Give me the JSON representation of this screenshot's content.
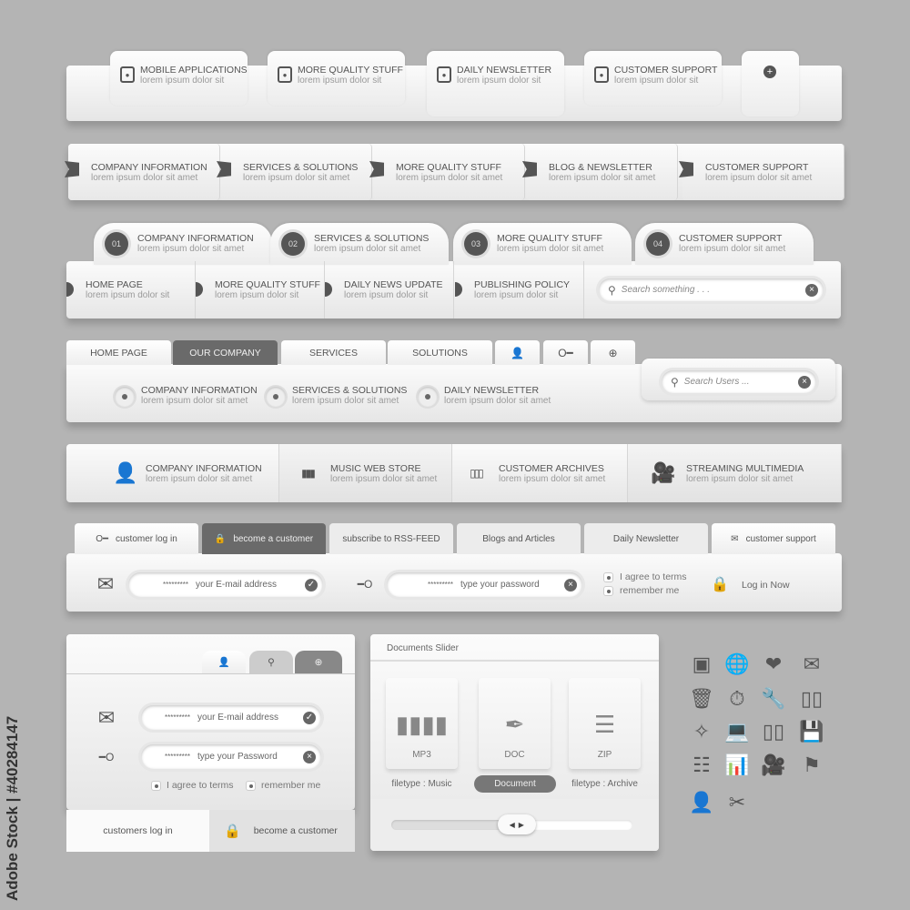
{
  "watermark": "Adobe Stock | #40284147",
  "row1": {
    "tabs": [
      {
        "title": "MOBILE APPLICATIONS",
        "sub": "lorem ipsum dolor sit"
      },
      {
        "title": "MORE QUALITY STUFF",
        "sub": "lorem ipsum dolor sit"
      },
      {
        "title": "DAILY NEWSLETTER",
        "sub": "lorem ipsum dolor sit"
      },
      {
        "title": "CUSTOMER SUPPORT",
        "sub": "lorem ipsum dolor sit"
      }
    ],
    "add_icon": "plus-circle-icon"
  },
  "row2": {
    "items": [
      {
        "title": "COMPANY INFORMATION",
        "sub": "lorem ipsum dolor sit amet"
      },
      {
        "title": "SERVICES & SOLUTIONS",
        "sub": "lorem ipsum dolor sit amet"
      },
      {
        "title": "MORE QUALITY STUFF",
        "sub": "lorem ipsum dolor sit amet"
      },
      {
        "title": "BLOG & NEWSLETTER",
        "sub": "lorem ipsum dolor sit amet"
      },
      {
        "title": "CUSTOMER SUPPORT",
        "sub": "lorem ipsum dolor sit amet"
      }
    ]
  },
  "row3": {
    "tabs": [
      {
        "num": "01",
        "title": "COMPANY INFORMATION",
        "sub": "lorem ipsum dolor sit amet"
      },
      {
        "num": "02",
        "title": "SERVICES & SOLUTIONS",
        "sub": "lorem ipsum dolor sit amet"
      },
      {
        "num": "03",
        "title": "MORE QUALITY STUFF",
        "sub": "lorem ipsum dolor sit amet"
      },
      {
        "num": "04",
        "title": "CUSTOMER SUPPORT",
        "sub": "lorem ipsum dolor sit amet"
      }
    ],
    "items": [
      {
        "title": "HOME PAGE",
        "sub": "lorem ipsum dolor sit"
      },
      {
        "title": "MORE QUALITY STUFF",
        "sub": "lorem ipsum dolor sit"
      },
      {
        "title": "DAILY  NEWS UPDATE",
        "sub": "lorem ipsum dolor sit"
      },
      {
        "title": "PUBLISHING POLICY",
        "sub": "lorem ipsum dolor sit"
      }
    ],
    "search_placeholder": "Search something . . ."
  },
  "row4": {
    "tabs": [
      "HOME PAGE",
      "OUR COMPANY",
      "SERVICES",
      "SOLUTIONS"
    ],
    "active": "OUR COMPANY",
    "icon_tabs": [
      "user-icon",
      "key-icon",
      "plus-circle-icon"
    ],
    "items": [
      {
        "title": "COMPANY INFORMATION",
        "sub": "lorem ipsum dolor sit amet"
      },
      {
        "title": "SERVICES & SOLUTIONS",
        "sub": "lorem ipsum dolor sit amet"
      },
      {
        "title": "DAILY NEWSLETTER",
        "sub": "lorem ipsum dolor sit amet"
      }
    ],
    "search_placeholder": "Search Users ..."
  },
  "row5": {
    "items": [
      {
        "icon": "user-icon",
        "title": "COMPANY INFORMATION",
        "sub": "lorem ipsum dolor sit amet"
      },
      {
        "icon": "equalizer-icon",
        "title": "MUSIC WEB STORE",
        "sub": "lorem ipsum dolor sit amet"
      },
      {
        "icon": "binders-icon",
        "title": "CUSTOMER ARCHIVES",
        "sub": "lorem ipsum dolor sit amet"
      },
      {
        "icon": "video-camera-icon",
        "title": "STREAMING MULTIMEDIA",
        "sub": "lorem ipsum dolor sit amet"
      }
    ]
  },
  "row6": {
    "tabs": [
      "customer log in",
      "become a customer",
      "subscribe to RSS-FEED",
      "Blogs and Articles",
      "Daily Newsletter",
      "customer support"
    ],
    "active": "become a customer",
    "email_mask": "*********",
    "email_placeholder": "your E-mail address",
    "password_mask": "*********",
    "password_placeholder": "type your password",
    "agree": "I agree to terms",
    "remember": "remember me",
    "login": "Log in Now"
  },
  "login_panel": {
    "email_mask": "*********",
    "email_placeholder": "your E-mail address",
    "password_mask": "*********",
    "password_placeholder": "type your Password",
    "agree": "I agree to terms",
    "remember": "remember me",
    "tab_login": "customers log in",
    "tab_become": "become a customer"
  },
  "slider": {
    "title": "Documents Slider",
    "cards": [
      {
        "type": "MP3",
        "label": "filetype : Music"
      },
      {
        "type": "DOC",
        "label": "Document",
        "selected": true
      },
      {
        "type": "ZIP",
        "label": "filetype : Archive"
      }
    ],
    "position_percent": 52
  },
  "icon_grid": [
    "browser-cursor-icon",
    "globe-upload-icon",
    "heart-add-icon",
    "envelope-icon",
    "trash-icon",
    "stopwatch-icon",
    "tools-icon",
    "binders-icon",
    "compass-icon",
    "laptop-icon",
    "battery-icon",
    "floppy-upload-icon",
    "sliders-icon",
    "chart-icon",
    "video-camera-icon",
    "flag-icon",
    "user-icon",
    "scissors-icon"
  ]
}
